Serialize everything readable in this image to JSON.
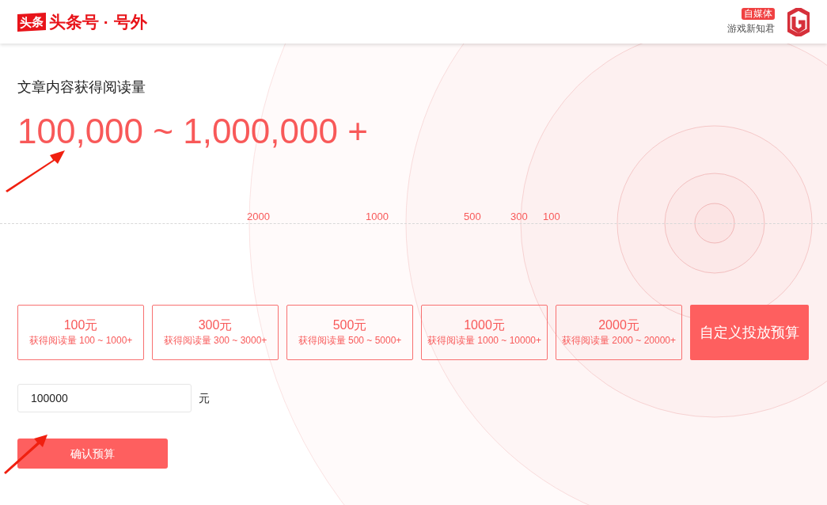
{
  "header": {
    "logo_badge": "头条",
    "logo_text": "头条号 · 号外",
    "account_badge": "自媒体",
    "account_name": "游戏新知君"
  },
  "headline": {
    "label": "文章内容获得阅读量",
    "range": "100,000 ~ 1,000,000 +"
  },
  "scale_labels": [
    "2000",
    "1000",
    "500",
    "300",
    "100"
  ],
  "budget_options": [
    {
      "kind": "preset",
      "amount": "100元",
      "reads": "获得阅读量 100 ~ 1000+",
      "selected": false
    },
    {
      "kind": "preset",
      "amount": "300元",
      "reads": "获得阅读量 300 ~ 3000+",
      "selected": false
    },
    {
      "kind": "preset",
      "amount": "500元",
      "reads": "获得阅读量 500 ~ 5000+",
      "selected": false
    },
    {
      "kind": "preset",
      "amount": "1000元",
      "reads": "获得阅读量 1000 ~ 10000+",
      "selected": false
    },
    {
      "kind": "preset",
      "amount": "2000元",
      "reads": "获得阅读量 2000 ~ 20000+",
      "selected": false
    },
    {
      "kind": "custom",
      "label": "自定义投放预算",
      "selected": true
    }
  ],
  "budget_input": {
    "value": "100000",
    "unit": "元"
  },
  "confirm_button": "确认预算"
}
